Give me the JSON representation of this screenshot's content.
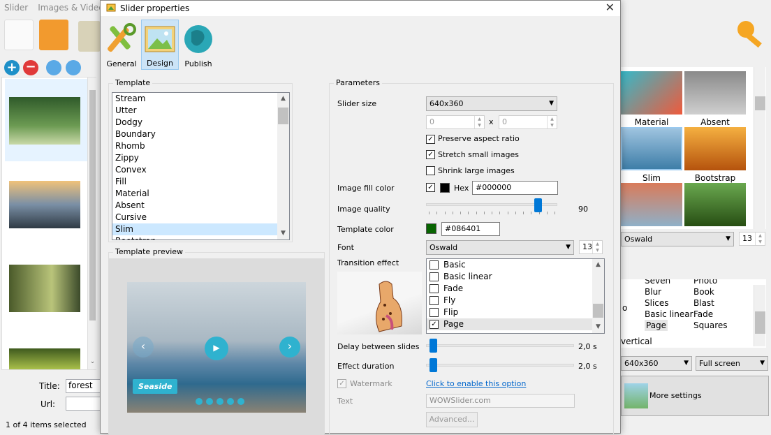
{
  "background_app": {
    "menu": [
      "Slider",
      "Images & Videos"
    ],
    "thumbnails_status": "1 of 4 items selected",
    "title_label": "Title:",
    "title_value": "forest",
    "url_label": "Url:",
    "right_templates": [
      "Material",
      "Absent",
      "Slim",
      "Bootstrap"
    ],
    "right_font": "Oswald",
    "right_font_size": "13",
    "right_effects_col1": [
      "Seven",
      "Blur",
      "Slices",
      "Basic linear",
      "Page"
    ],
    "right_effects_col2": [
      "Photo",
      "Book",
      "Blast",
      "Fade",
      "Squares"
    ],
    "right_effects_col0": [
      "o",
      "vertical"
    ],
    "right_size": "640x360",
    "right_mode": "Full screen",
    "more_settings": "More settings"
  },
  "dialog": {
    "title": "Slider properties",
    "close_glyph": "✕",
    "tabs": [
      {
        "label": "General"
      },
      {
        "label": "Design"
      },
      {
        "label": "Publish"
      }
    ],
    "template_group": "Template",
    "templates": [
      "Stream",
      "Utter",
      "Dodgy",
      "Boundary",
      "Rhomb",
      "Zippy",
      "Convex",
      "Fill",
      "Material",
      "Absent",
      "Cursive",
      "Slim",
      "Bootstrap"
    ],
    "selected_template": "Slim",
    "preview_group": "Template preview",
    "preview_caption": "Seaside",
    "parameters_group": "Parameters",
    "slider_size_label": "Slider size",
    "slider_size_value": "640x360",
    "width_value": "0",
    "height_value": "0",
    "x_sep": "x",
    "preserve_aspect": "Preserve aspect ratio",
    "stretch_small": "Stretch small images",
    "shrink_large": "Shrink large images",
    "fill_color_label": "Image fill color",
    "hex_label": "Hex",
    "fill_hex": "#000000",
    "quality_label": "Image quality",
    "quality_value": "90",
    "quality_fraction": 0.9,
    "template_color_label": "Template color",
    "template_color_hex": "#086401",
    "template_color": "#086401",
    "font_label": "Font",
    "font_value": "Oswald",
    "font_size": "13",
    "transition_label": "Transition effect",
    "effects": [
      {
        "name": "Basic",
        "checked": false
      },
      {
        "name": "Basic linear",
        "checked": false
      },
      {
        "name": "Fade",
        "checked": false
      },
      {
        "name": "Fly",
        "checked": false
      },
      {
        "name": "Flip",
        "checked": false
      },
      {
        "name": "Page",
        "checked": true
      }
    ],
    "delay_label": "Delay between slides",
    "delay_value": "2,0 s",
    "duration_label": "Effect duration",
    "duration_value": "2,0 s",
    "watermark_label": "Watermark",
    "enable_link": "Click to enable this option",
    "text_label": "Text",
    "text_value": "WOWSlider.com",
    "advanced_button": "Advanced...",
    "check_mark": "✓"
  }
}
